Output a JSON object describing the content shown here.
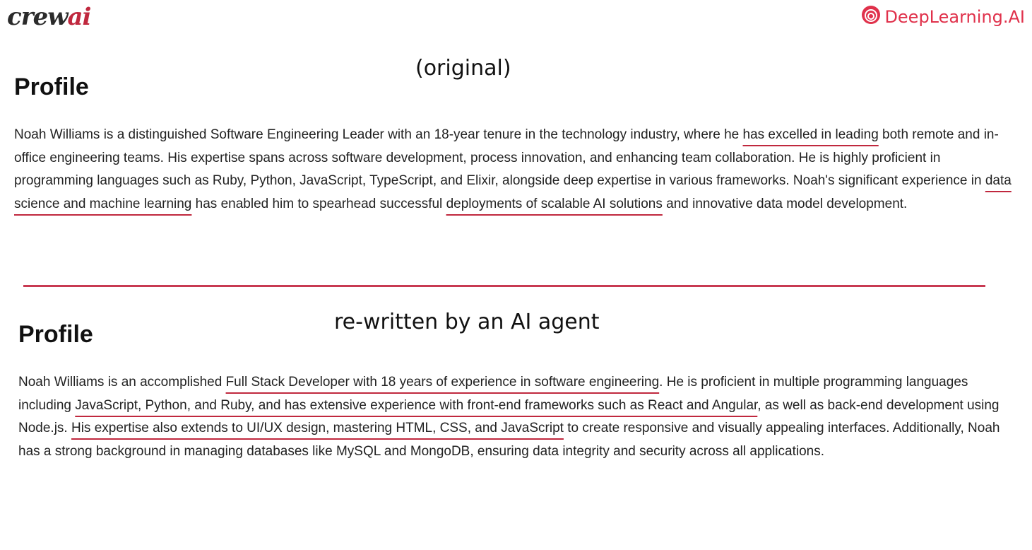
{
  "logos": {
    "crewai_part1": "crew",
    "crewai_part2": "ai",
    "deeplearning": "DeepLearning.AI"
  },
  "original": {
    "caption": "(original)",
    "heading": "Profile",
    "segments": [
      {
        "text": "Noah Williams is a distinguished Software Engineering Leader with an 18-year tenure in the technology industry, where he ",
        "hl": false
      },
      {
        "text": "has excelled in leading",
        "hl": true
      },
      {
        "text": " both remote and in-office engineering teams. His expertise spans across software development, process innovation, and enhancing team collaboration. He is highly proficient in programming languages such as Ruby, Python, JavaScript, TypeScript, and Elixir, alongside deep expertise in various frameworks. Noah's significant experience in ",
        "hl": false
      },
      {
        "text": "data science and machine learning",
        "hl": true
      },
      {
        "text": " has enabled him to spearhead successful ",
        "hl": false
      },
      {
        "text": "deployments of scalable AI solutions",
        "hl": true
      },
      {
        "text": " and innovative data model development.",
        "hl": false
      }
    ]
  },
  "rewritten": {
    "caption": "re-written by an AI agent",
    "heading": "Profile",
    "segments": [
      {
        "text": "Noah Williams is an accomplished ",
        "hl": false
      },
      {
        "text": "Full Stack Developer with 18 years of experience in software engineering",
        "hl": true
      },
      {
        "text": ". He is proficient in multiple programming languages including ",
        "hl": false
      },
      {
        "text": "JavaScript, Python, and Ruby, and has extensive experience with front-end frameworks such as React and Angular",
        "hl": true
      },
      {
        "text": ", as well as back-end development using Node.js. ",
        "hl": false
      },
      {
        "text": "His expertise also extends to UI/UX design, mastering HTML, CSS, and JavaScript",
        "hl": true
      },
      {
        "text": " to create responsive and visually appealing interfaces. Additionally, Noah has a strong background in managing databases like MySQL and MongoDB, ensuring data integrity and security across all applications.",
        "hl": false
      }
    ]
  },
  "colors": {
    "accent": "#c83a52",
    "brand_red": "#e0314b"
  }
}
